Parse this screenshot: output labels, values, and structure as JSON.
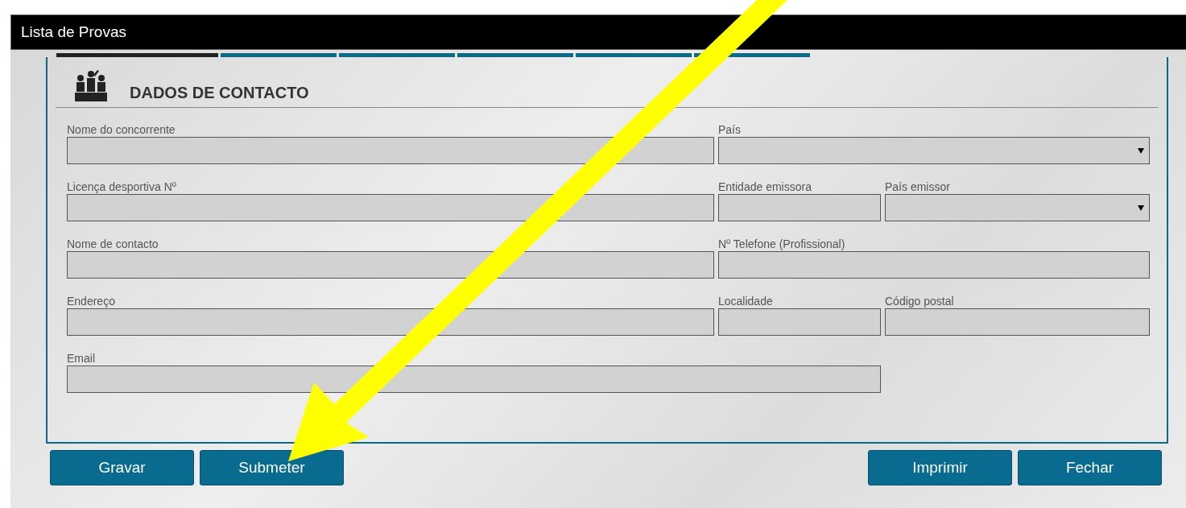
{
  "window": {
    "title": "Lista de Provas"
  },
  "section": {
    "title": "DADOS DE CONTACTO"
  },
  "form_rows": [
    {
      "fields": [
        {
          "label": "Nome do concorrente",
          "kind": "text"
        },
        {
          "label": "País",
          "kind": "select"
        }
      ]
    },
    {
      "fields": [
        {
          "label": "Licença desportiva Nº",
          "kind": "text"
        },
        {
          "label": "Entidade emissora",
          "kind": "text"
        },
        {
          "label": "País emissor",
          "kind": "select"
        }
      ]
    },
    {
      "fields": [
        {
          "label": "Nome de contacto",
          "kind": "text"
        },
        {
          "label": "Nº Telefone (Profissional)",
          "kind": "text"
        }
      ]
    },
    {
      "fields": [
        {
          "label": "Endereço",
          "kind": "text"
        },
        {
          "label": "Localidade",
          "kind": "text"
        },
        {
          "label": "Código postal",
          "kind": "text"
        }
      ]
    },
    {
      "fields": [
        {
          "label": "Email",
          "kind": "text"
        }
      ]
    }
  ],
  "buttons_left": [
    "Gravar",
    "Submeter"
  ],
  "buttons_right": [
    "Imprimir",
    "Fechar"
  ]
}
